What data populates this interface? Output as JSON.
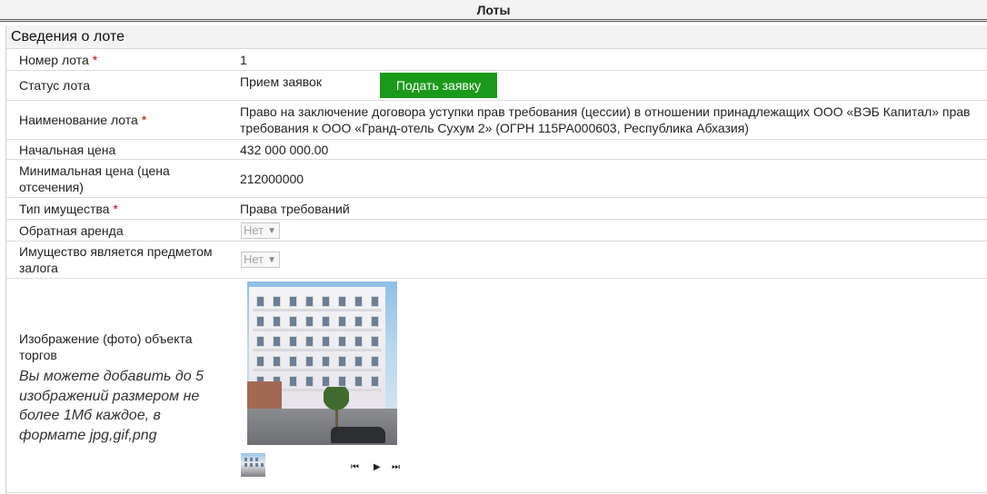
{
  "header": {
    "title": "Лоты"
  },
  "section": {
    "title": "Сведения о лоте"
  },
  "required_mark": "*",
  "fields": {
    "lot_number": {
      "label": "Номер лота",
      "value": "1"
    },
    "lot_status": {
      "label": "Статус лота",
      "value": "Прием заявок",
      "button": "Подать заявку"
    },
    "lot_name": {
      "label": "Наименование лота",
      "value_line1": "Право на заключение договора уступки прав требования (цессии) в отношении принадлежащих ООО «ВЭБ Капитал» прав",
      "value_line2": "требования к ООО «Гранд-отель Сухум 2» (ОГРН 115РА000603, Республика Абхазия)"
    },
    "start_price": {
      "label": "Начальная цена",
      "value": "432 000 000.00"
    },
    "min_price": {
      "label_line1": "Минимальная цена (цена",
      "label_line2": "отсечения)",
      "value": "212000000"
    },
    "property_type": {
      "label": "Тип имущества",
      "value": "Права требований"
    },
    "leaseback": {
      "label": "Обратная аренда",
      "selected": "Нет"
    },
    "pledge": {
      "label_line1": "Имущество является предметом",
      "label_line2": "залога",
      "selected": "Нет"
    },
    "image": {
      "label_line1": "Изображение (фото) объекта",
      "label_line2": "торгов",
      "hint_line1": "Вы можете добавить до 5",
      "hint_line2": "изображений размером не",
      "hint_line3": "более 1Мб каждое, в",
      "hint_line4": "формате jpg,gif,png"
    }
  },
  "pager": {
    "first": "⏮",
    "play": "▶",
    "last": "⏭"
  },
  "colors": {
    "submit_button": "#1a9a1a",
    "required": "#d30000",
    "header_bg": "#f3f3f3"
  }
}
